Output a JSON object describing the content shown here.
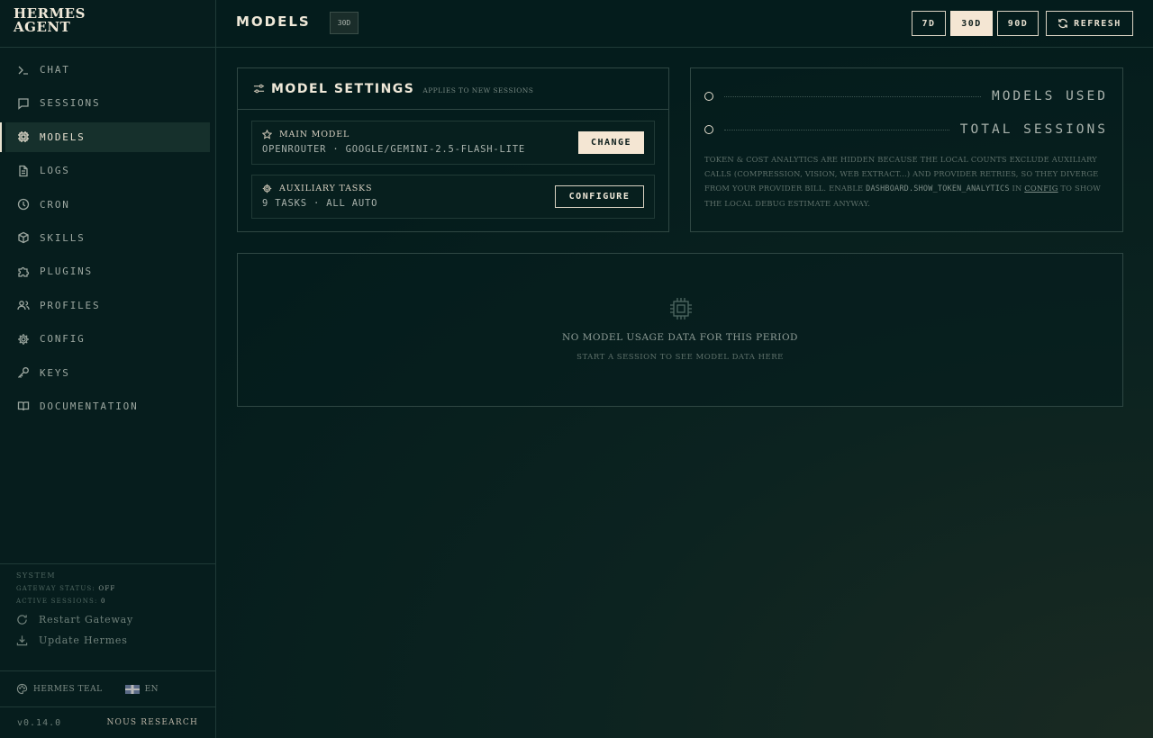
{
  "brand": {
    "name": "HERMES AGENT"
  },
  "sidebar": {
    "items": [
      {
        "label": "CHAT",
        "icon": "terminal-icon"
      },
      {
        "label": "SESSIONS",
        "icon": "message-icon"
      },
      {
        "label": "MODELS",
        "icon": "chip-icon",
        "active": true
      },
      {
        "label": "LOGS",
        "icon": "file-icon"
      },
      {
        "label": "CRON",
        "icon": "clock-icon"
      },
      {
        "label": "SKILLS",
        "icon": "package-icon"
      },
      {
        "label": "PLUGINS",
        "icon": "puzzle-icon"
      },
      {
        "label": "PROFILES",
        "icon": "users-icon"
      },
      {
        "label": "CONFIG",
        "icon": "gear-icon"
      },
      {
        "label": "KEYS",
        "icon": "key-icon"
      },
      {
        "label": "DOCUMENTATION",
        "icon": "book-icon"
      }
    ],
    "system": {
      "title": "SYSTEM",
      "gateway_label": "GATEWAY STATUS:",
      "gateway_value": "OFF",
      "sessions_label": "ACTIVE SESSIONS:",
      "sessions_value": "0",
      "restart": "Restart Gateway",
      "update": "Update Hermes"
    },
    "theme": "HERMES TEAL",
    "language": "EN",
    "version": "v0.14.0",
    "credit": "NOUS RESEARCH"
  },
  "header": {
    "title": "MODELS",
    "period_badge": "30D",
    "periods": [
      "7D",
      "30D",
      "90D"
    ],
    "active_period": "30D",
    "refresh": "REFRESH"
  },
  "model_settings": {
    "title": "MODEL SETTINGS",
    "subtitle": "APPLIES TO NEW SESSIONS",
    "main_model": {
      "label": "MAIN MODEL",
      "value": "OPENROUTER · GOOGLE/GEMINI-2.5-FLASH-LITE",
      "button": "CHANGE"
    },
    "auxiliary": {
      "label": "AUXILIARY TASKS",
      "value": "9 TASKS · ALL AUTO",
      "button": "CONFIGURE"
    }
  },
  "stats": {
    "models_used_label": "MODELS USED",
    "total_sessions_label": "TOTAL SESSIONS",
    "notice_pre": "TOKEN & COST ANALYTICS ARE HIDDEN BECAUSE THE LOCAL COUNTS EXCLUDE AUXILIARY CALLS (COMPRESSION, VISION, WEB EXTRACT...) AND PROVIDER RETRIES, SO THEY DIVERGE FROM YOUR PROVIDER BILL. ENABLE ",
    "notice_code": "DASHBOARD.SHOW_TOKEN_ANALYTICS",
    "notice_mid": " IN ",
    "notice_link": "CONFIG",
    "notice_post": " TO SHOW THE LOCAL DEBUG ESTIMATE ANYWAY."
  },
  "empty_state": {
    "icon": "chip-icon",
    "title": "NO MODEL USAGE DATA FOR THIS PERIOD",
    "subtitle": "START A SESSION TO SEE MODEL DATA HERE"
  },
  "colors": {
    "background": "#041c1c",
    "accent": "#f4e6d3",
    "border": "#2f4743",
    "text": "#d6cfc0"
  }
}
